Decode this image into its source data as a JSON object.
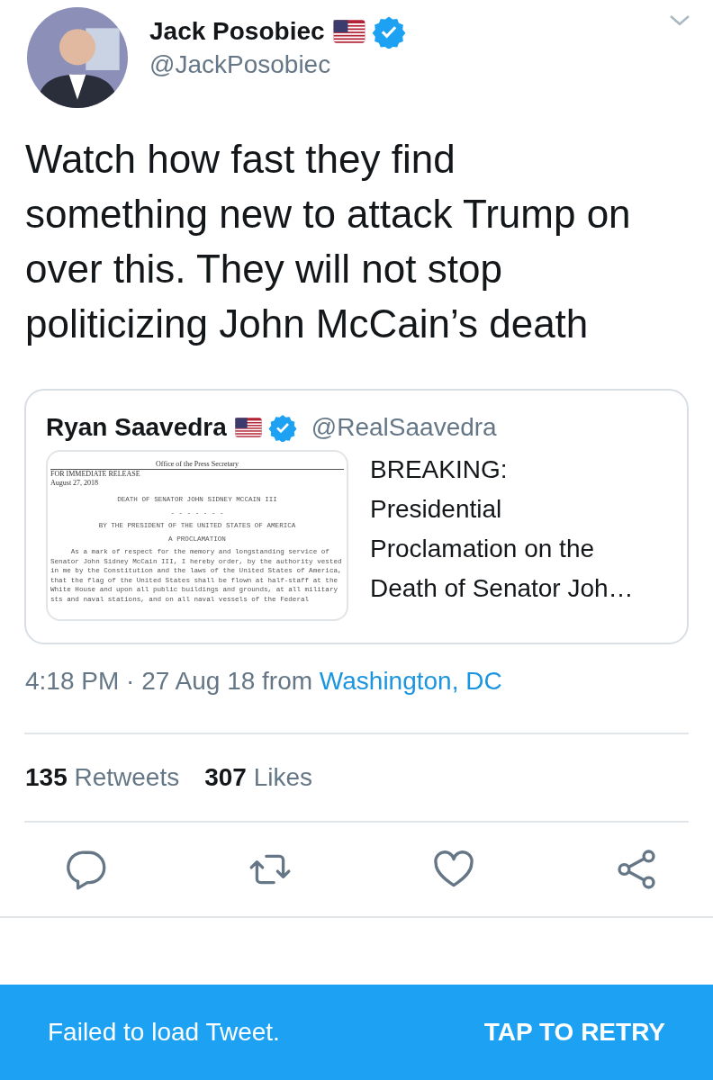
{
  "author": {
    "name": "Jack Posobiec",
    "verified": true,
    "handle": "@JackPosobiec"
  },
  "text": "Watch how fast they find something new to attack Trump on over this. They will not stop politicizing John McCain’s death",
  "quote": {
    "name": "Ryan Saavedra",
    "verified": true,
    "handle": "@RealSaavedra",
    "summary": "BREAKING: Presidential Proclamation on the Death of Senator Joh…",
    "document": {
      "office": "Office of the Press Secretary",
      "release": "FOR IMMEDIATE RELEASE",
      "date": "August 27, 2018",
      "title": "DEATH OF SENATOR JOHN SIDNEY MCCAIN III",
      "dashes": "- - - - - - -",
      "byline": "BY THE PRESIDENT OF THE UNITED STATES OF AMERICA",
      "heading": "A PROCLAMATION",
      "body": [
        "     As a mark of respect for the memory and longstanding service of",
        "Senator John Sidney McCain III, I hereby order, by the authority vested",
        "in me by the Constitution and the laws of the United States of America,",
        "that the flag of the United States shall be flown at half-staff at the",
        "White House and upon all public buildings and grounds, at all military",
        "sts and naval stations, and on all naval vessels of the Federal"
      ]
    }
  },
  "time": "4:18 PM · 27 Aug 18",
  "source_prefix": "from",
  "source": "Washington, DC",
  "stats": [
    {
      "count": "135",
      "label": "Retweets"
    },
    {
      "count": "307",
      "label": "Likes"
    }
  ],
  "actions": [
    {
      "kind": "reply"
    },
    {
      "kind": "retweet"
    },
    {
      "kind": "like"
    },
    {
      "kind": "share"
    }
  ],
  "snackbar": {
    "message": "Failed to load Tweet.",
    "action": "TAP TO RETRY"
  }
}
